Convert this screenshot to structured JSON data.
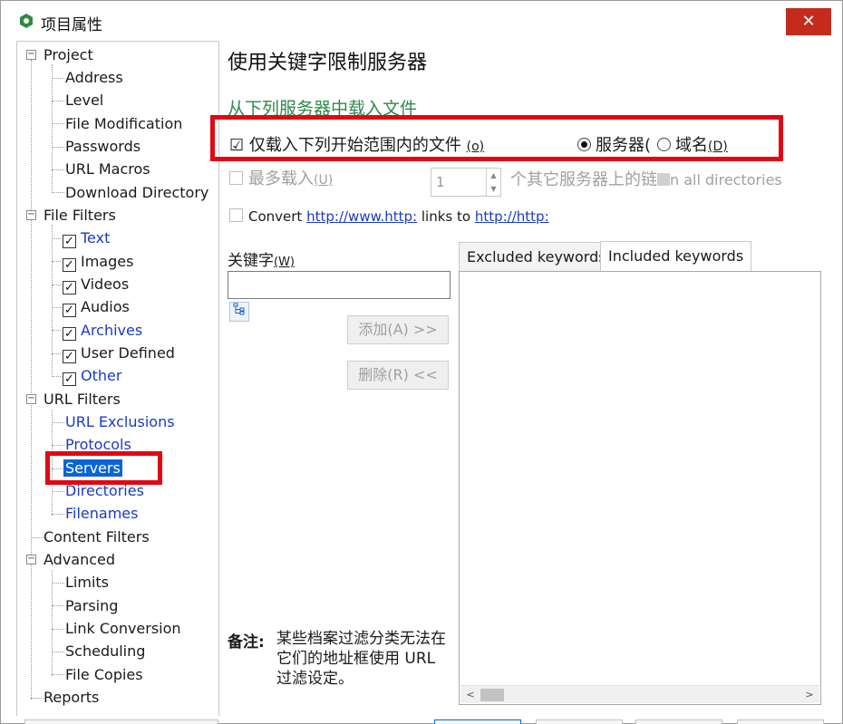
{
  "window": {
    "title": "项目属性",
    "close_label": "✕"
  },
  "tree": {
    "expander_minus": "−",
    "check_mark": "✓",
    "items": [
      {
        "label": "Project"
      },
      {
        "label": "Address"
      },
      {
        "label": "Level"
      },
      {
        "label": "File Modification"
      },
      {
        "label": "Passwords"
      },
      {
        "label": "URL Macros"
      },
      {
        "label": "Download Directory"
      },
      {
        "label": "File Filters"
      },
      {
        "label": "Text"
      },
      {
        "label": "Images"
      },
      {
        "label": "Videos"
      },
      {
        "label": "Audios"
      },
      {
        "label": "Archives"
      },
      {
        "label": "User Defined"
      },
      {
        "label": "Other"
      },
      {
        "label": "URL Filters"
      },
      {
        "label": "URL Exclusions"
      },
      {
        "label": "Protocols"
      },
      {
        "label": "Servers"
      },
      {
        "label": "Directories"
      },
      {
        "label": "Filenames"
      },
      {
        "label": "Content Filters"
      },
      {
        "label": "Advanced"
      },
      {
        "label": "Limits"
      },
      {
        "label": "Parsing"
      },
      {
        "label": "Link Conversion"
      },
      {
        "label": "Scheduling"
      },
      {
        "label": "File Copies"
      },
      {
        "label": "Reports"
      }
    ]
  },
  "main": {
    "heading": "使用关键字限制服务器",
    "subheading": "从下列服务器中载入文件",
    "only_load_checked": "☑",
    "only_load_label": "仅载入下列开始范围内的文件",
    "only_load_hotkey": "(o)",
    "radio_server_label": "服务器(",
    "radio_domain_label": "域名",
    "radio_domain_hotkey": "(D)",
    "max_load_label": "最多载入",
    "max_load_hotkey": "(U)",
    "max_load_value": "1",
    "max_load_suffix": "个其它服务器上的链",
    "max_load_suffix2": "n all directories",
    "convert_label": "Convert",
    "convert_link1": "http://www.http:",
    "convert_mid": "links to",
    "convert_link2": "http://http:",
    "keyword_label": "关键字",
    "keyword_hotkey": "(W)",
    "keyword_value": "",
    "add_button": "添加(A) >>",
    "remove_button": "删除(R) <<",
    "tab_excluded": "Excluded keywords",
    "tab_included": "Included keywords",
    "note_title": "备注:",
    "note_body": "某些档案过滤分类无法在它们的地址框使用 URL 过滤设定。",
    "spin_up": "▲",
    "spin_down": "▼",
    "scroll_left": "<",
    "scroll_right": ">"
  },
  "colors": {
    "highlight_red": "#e30613",
    "selection_blue": "#0a64d6",
    "green_heading": "#2d8a4a",
    "link_blue": "#1a3ac8"
  }
}
